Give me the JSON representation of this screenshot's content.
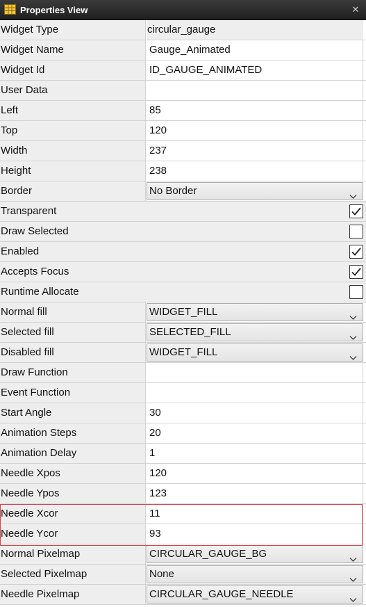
{
  "panel": {
    "title": "Properties View"
  },
  "rows": [
    {
      "label": "Widget Type",
      "value": "circular_gauge",
      "kind": "readonly"
    },
    {
      "label": "Widget Name",
      "value": "Gauge_Animated",
      "kind": "text"
    },
    {
      "label": "Widget Id",
      "value": "ID_GAUGE_ANIMATED",
      "kind": "text"
    },
    {
      "label": "User Data",
      "value": "",
      "kind": "text"
    },
    {
      "label": "Left",
      "value": "85",
      "kind": "text"
    },
    {
      "label": "Top",
      "value": "120",
      "kind": "text"
    },
    {
      "label": "Width",
      "value": "237",
      "kind": "text"
    },
    {
      "label": "Height",
      "value": "238",
      "kind": "text"
    },
    {
      "label": "Border",
      "value": "No Border",
      "kind": "select"
    },
    {
      "label": "Transparent",
      "checked": true,
      "kind": "checkbox"
    },
    {
      "label": "Draw Selected",
      "checked": false,
      "kind": "checkbox"
    },
    {
      "label": "Enabled",
      "checked": true,
      "kind": "checkbox"
    },
    {
      "label": "Accepts Focus",
      "checked": true,
      "kind": "checkbox"
    },
    {
      "label": "Runtime Allocate",
      "checked": false,
      "kind": "checkbox"
    },
    {
      "label": "Normal fill",
      "value": "WIDGET_FILL",
      "kind": "select"
    },
    {
      "label": "Selected fill",
      "value": "SELECTED_FILL",
      "kind": "select"
    },
    {
      "label": "Disabled fill",
      "value": "WIDGET_FILL",
      "kind": "select"
    },
    {
      "label": "Draw Function",
      "value": "",
      "kind": "text"
    },
    {
      "label": "Event Function",
      "value": "",
      "kind": "text"
    },
    {
      "label": "Start Angle",
      "value": "30",
      "kind": "text"
    },
    {
      "label": "Animation Steps",
      "value": "20",
      "kind": "text"
    },
    {
      "label": "Animation Delay",
      "value": "1",
      "kind": "text"
    },
    {
      "label": "Needle Xpos",
      "value": "120",
      "kind": "text"
    },
    {
      "label": "Needle Ypos",
      "value": "123",
      "kind": "text"
    },
    {
      "label": "Needle Xcor",
      "value": "11",
      "kind": "text"
    },
    {
      "label": "Needle Ycor",
      "value": "93",
      "kind": "text"
    },
    {
      "label": "Normal Pixelmap",
      "value": "CIRCULAR_GAUGE_BG",
      "kind": "select"
    },
    {
      "label": "Selected Pixelmap",
      "value": "None",
      "kind": "select"
    },
    {
      "label": "Needle Pixelmap",
      "value": "CIRCULAR_GAUGE_NEEDLE",
      "kind": "select"
    }
  ],
  "colors": {
    "titlebar": "#2b2b2b",
    "highlight": "#d9434a",
    "label_bg": "#eeeeee"
  },
  "icons": {
    "title": "grid-table-icon",
    "close": "close-icon",
    "dropdown": "chevron-down-icon",
    "check": "check-icon"
  }
}
